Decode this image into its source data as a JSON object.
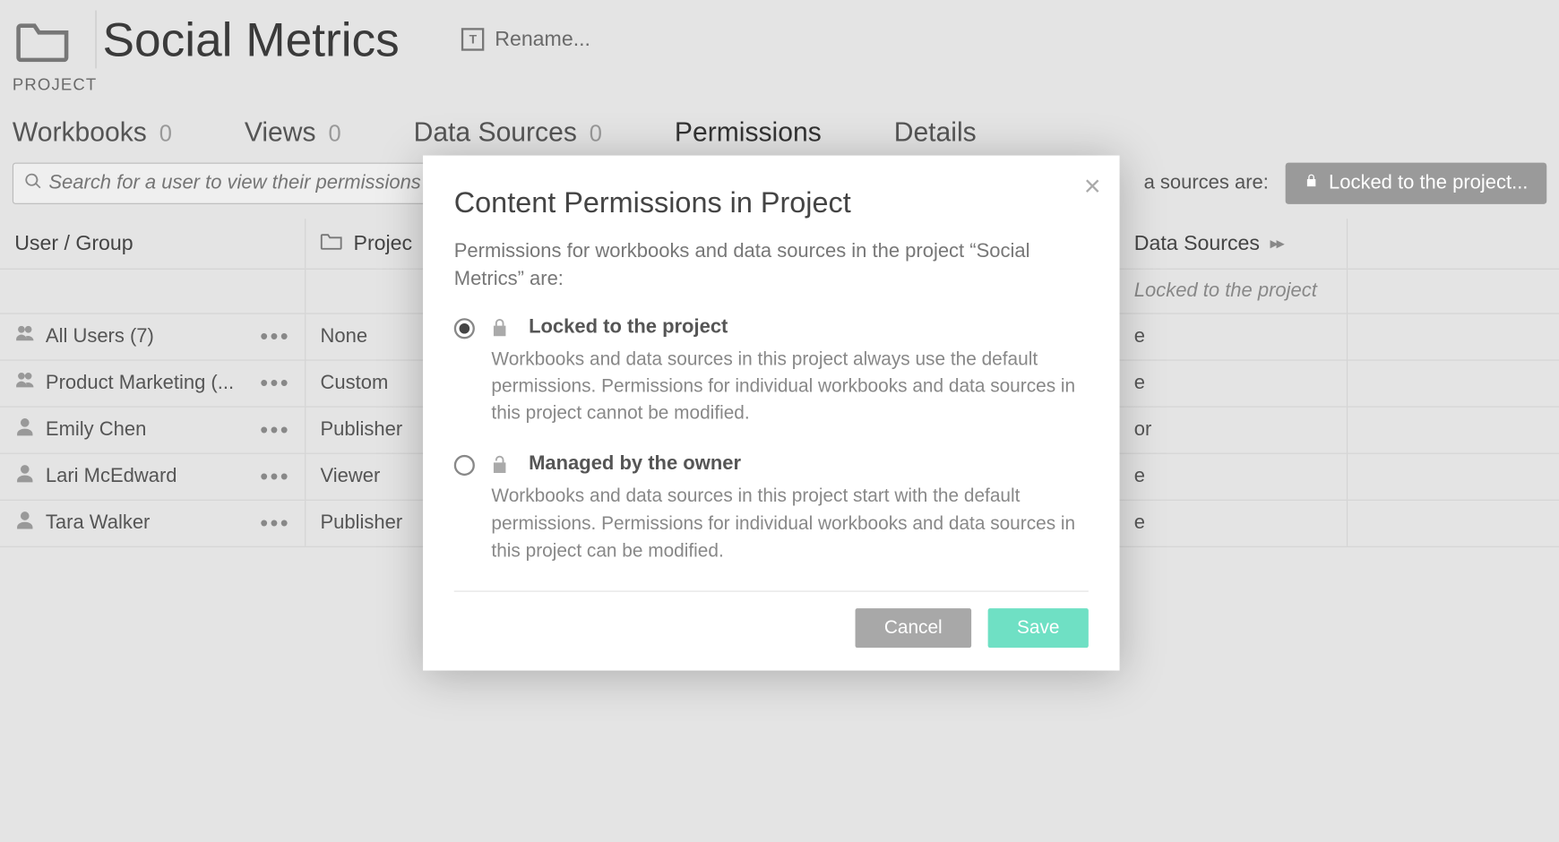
{
  "header": {
    "title": "Social Metrics",
    "rename_label": "Rename...",
    "breadcrumb": "PROJECT"
  },
  "tabs": {
    "workbooks": {
      "label": "Workbooks",
      "count": "0"
    },
    "views": {
      "label": "Views",
      "count": "0"
    },
    "data_sources": {
      "label": "Data Sources",
      "count": "0"
    },
    "permissions": {
      "label": "Permissions"
    },
    "details": {
      "label": "Details"
    }
  },
  "toolbar": {
    "search_placeholder": "Search for a user to view their permissions",
    "sources_are_label": "a sources are:",
    "locked_pill_label": "Locked to the project..."
  },
  "grid": {
    "headers": {
      "user_group": "User / Group",
      "project": "Projec",
      "data_sources": "Data Sources"
    },
    "note": "Locked to the project",
    "rows": [
      {
        "icon": "group",
        "name": "All Users (7)",
        "project": "None",
        "ds": "e"
      },
      {
        "icon": "group",
        "name": "Product Marketing (...",
        "project": "Custom",
        "ds": "e"
      },
      {
        "icon": "user",
        "name": "Emily Chen",
        "project": "Publisher",
        "ds": "or"
      },
      {
        "icon": "user",
        "name": "Lari McEdward",
        "project": "Viewer",
        "ds": "e"
      },
      {
        "icon": "user",
        "name": "Tara Walker",
        "project": "Publisher",
        "ds": "e"
      }
    ]
  },
  "modal": {
    "title": "Content Permissions in Project",
    "description": "Permissions for workbooks and data sources in the project “Social Metrics” are:",
    "options": {
      "locked": {
        "title": "Locked to the project",
        "body": "Workbooks and data sources in this project always use the default permissions. Permissions for individual workbooks and data sources in this project cannot be modified."
      },
      "managed": {
        "title": "Managed by the owner",
        "body": "Workbooks and data sources in this project start with the default permissions. Permissions for individual workbooks and data sources in this project can be modified."
      }
    },
    "cancel_label": "Cancel",
    "save_label": "Save"
  }
}
